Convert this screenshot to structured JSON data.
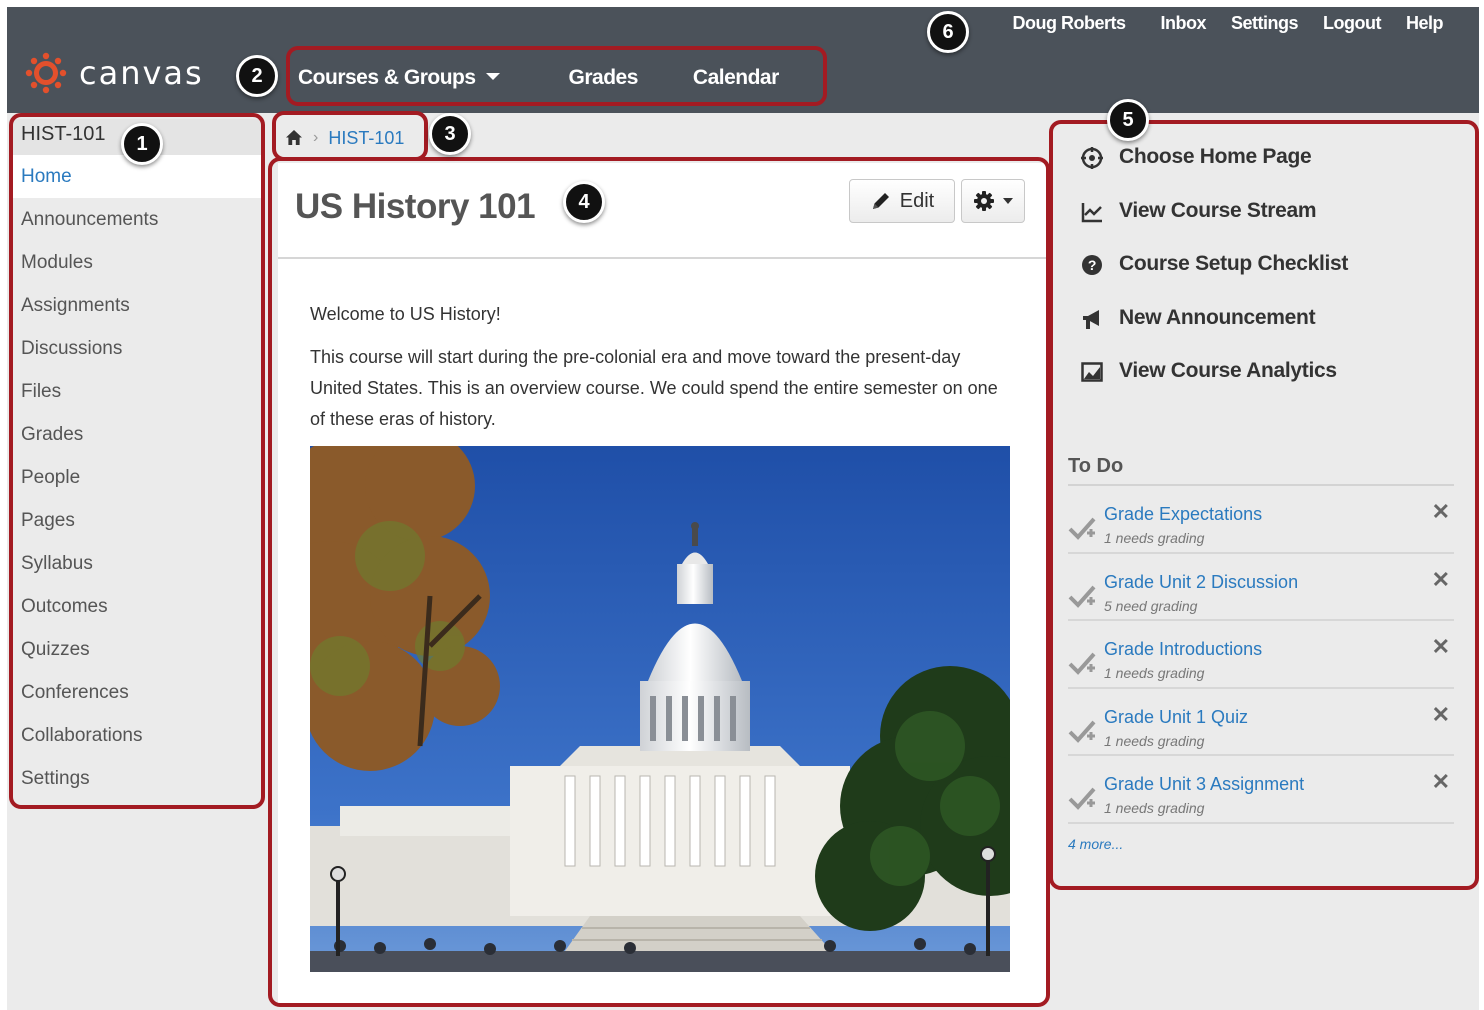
{
  "app": {
    "logo_text": "canvas"
  },
  "user_nav": {
    "user": "Doug Roberts",
    "inbox": "Inbox",
    "settings": "Settings",
    "logout": "Logout",
    "help": "Help"
  },
  "main_nav": {
    "courses": "Courses & Groups",
    "grades": "Grades",
    "calendar": "Calendar"
  },
  "course_nav": {
    "course_code": "HIST-101",
    "items": [
      {
        "label": "Home",
        "active": true
      },
      {
        "label": "Announcements"
      },
      {
        "label": "Modules"
      },
      {
        "label": "Assignments"
      },
      {
        "label": "Discussions"
      },
      {
        "label": "Files"
      },
      {
        "label": "Grades"
      },
      {
        "label": "People"
      },
      {
        "label": "Pages"
      },
      {
        "label": "Syllabus"
      },
      {
        "label": "Outcomes"
      },
      {
        "label": "Quizzes"
      },
      {
        "label": "Conferences"
      },
      {
        "label": "Collaborations"
      },
      {
        "label": "Settings"
      }
    ]
  },
  "breadcrumb": {
    "course": "HIST-101",
    "icon": "home-icon"
  },
  "content": {
    "title": "US History 101",
    "edit_label": "Edit",
    "intro": "Welcome to US History!",
    "paragraph": "This course will start during the pre-colonial era and move toward the present-day United States. This is an overview course. We could spend the entire semester on one of these eras of history."
  },
  "sidebar": {
    "actions": [
      {
        "label": "Choose Home Page",
        "icon": "target-icon"
      },
      {
        "label": "View Course Stream",
        "icon": "line-chart-icon"
      },
      {
        "label": "Course Setup Checklist",
        "icon": "question-circle-icon"
      },
      {
        "label": "New Announcement",
        "icon": "megaphone-icon"
      },
      {
        "label": "View Course Analytics",
        "icon": "image-chart-icon"
      }
    ],
    "todo": {
      "heading": "To Do",
      "items": [
        {
          "title": "Grade Expectations",
          "sub": "1 needs grading"
        },
        {
          "title": "Grade Unit 2 Discussion",
          "sub": "5 need grading"
        },
        {
          "title": "Grade Introductions",
          "sub": "1 needs grading"
        },
        {
          "title": "Grade Unit 1 Quiz",
          "sub": "1 needs grading"
        },
        {
          "title": "Grade Unit 3 Assignment",
          "sub": "1 needs grading"
        }
      ],
      "more": "4 more..."
    }
  },
  "annotations": [
    "1",
    "2",
    "3",
    "4",
    "5",
    "6"
  ],
  "colors": {
    "header": "#4b525a",
    "link": "#2a7abf",
    "highlight": "#a31b22",
    "logo": "#e3502c"
  }
}
